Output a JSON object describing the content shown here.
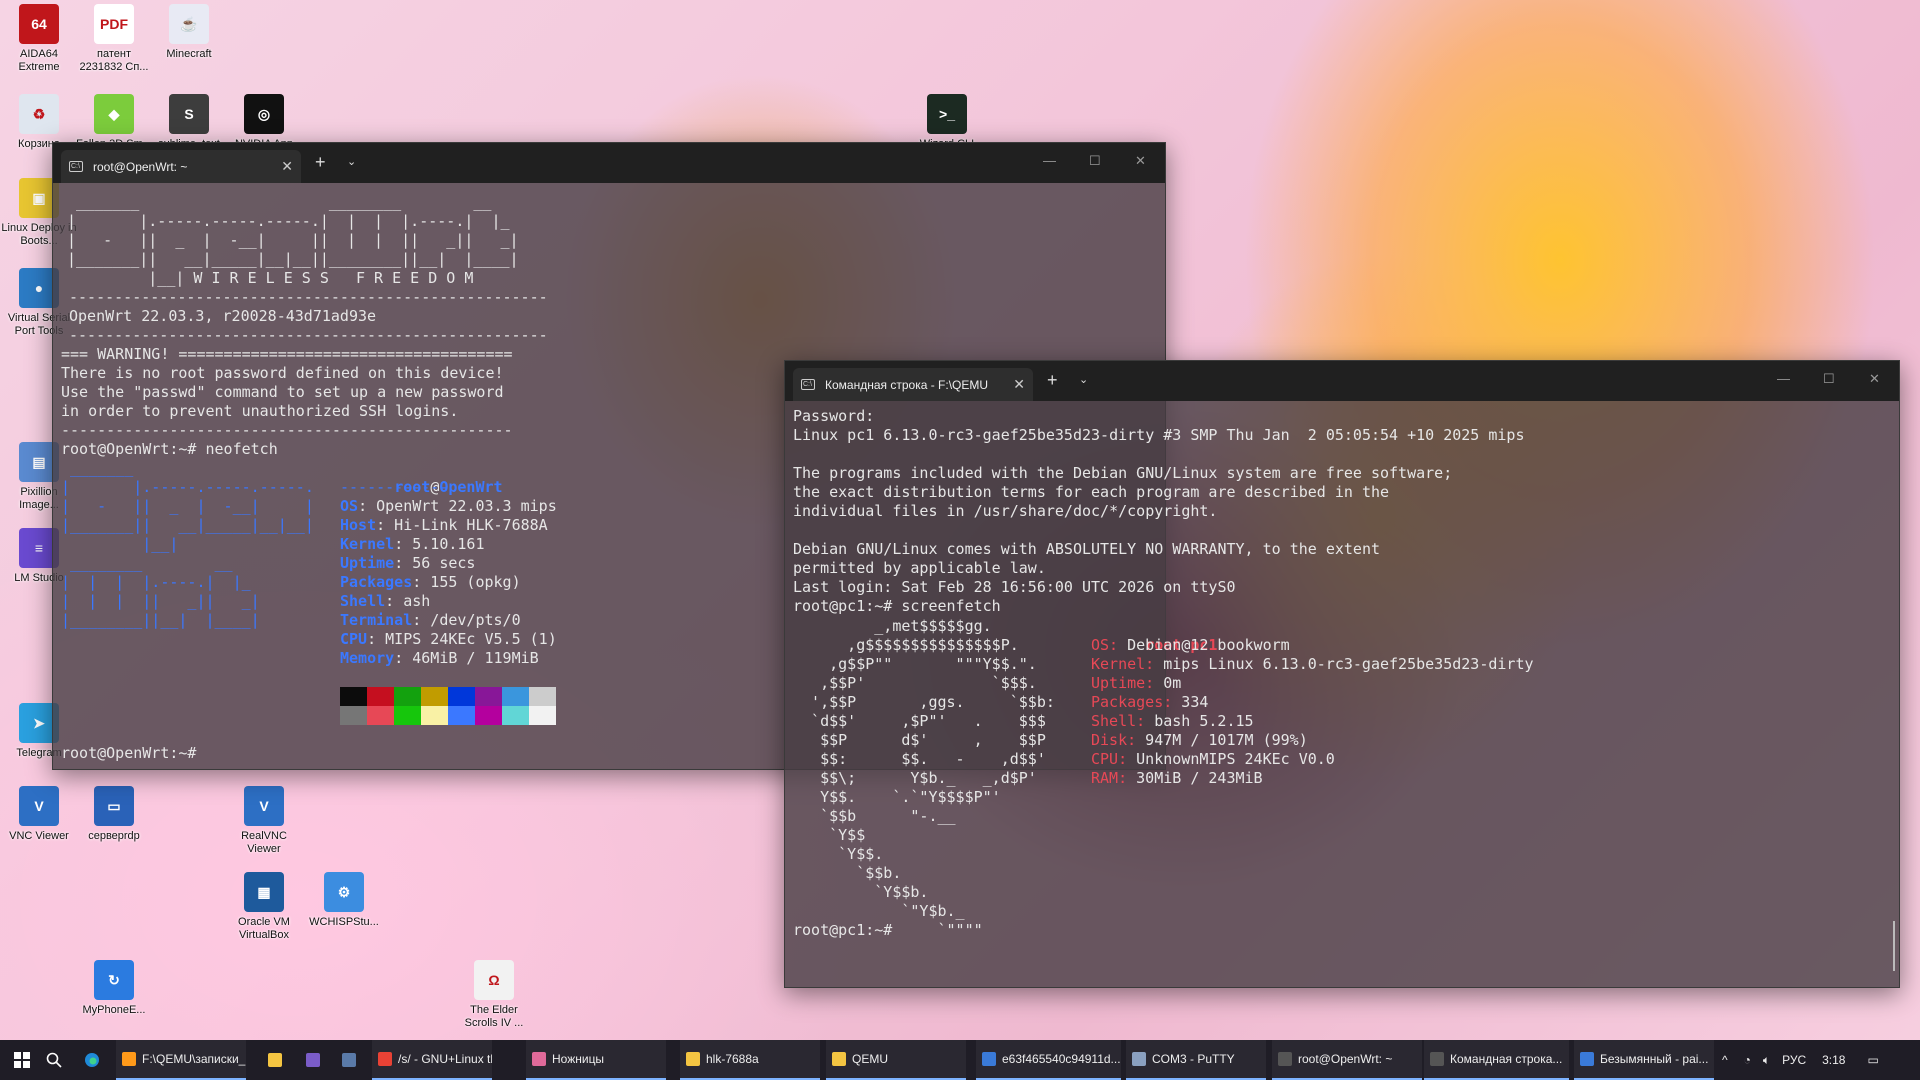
{
  "desktop": {
    "icons": [
      {
        "label": "AIDA64 Extreme",
        "icon": "aida64-icon",
        "color": "#c0161b",
        "text": "64"
      },
      {
        "label": "патент 2231832 Сп...",
        "icon": "pdf-icon",
        "color": "#ffffff",
        "text": "PDF"
      },
      {
        "label": "Minecraft",
        "icon": "java-icon",
        "color": "#e8eaf4",
        "text": "☕"
      },
      {
        "label": "Корзина",
        "icon": "recycle-bin-icon",
        "color": "#dfe6ef",
        "text": "♻"
      },
      {
        "label": "Fallen 3D Sm...",
        "icon": "cube-icon",
        "color": "#7ccc3c",
        "text": "◆"
      },
      {
        "label": "sublime_text",
        "icon": "sublime-icon",
        "color": "#3d3d3d",
        "text": "S"
      },
      {
        "label": "NVIDIA App",
        "icon": "nvidia-icon",
        "color": "#111111",
        "text": "◎"
      },
      {
        "label": "Linux Deploy in Boots...",
        "icon": "box-icon",
        "color": "#e7c531",
        "text": "▣"
      },
      {
        "label": "Virtual Serial Port Tools",
        "icon": "globe-icon",
        "color": "#2c7bc4",
        "text": "●"
      },
      {
        "label": "Pixillion Image...",
        "icon": "image-icon",
        "color": "#5a8ad0",
        "text": "▤"
      },
      {
        "label": "LM Studio",
        "icon": "lmstudio-icon",
        "color": "#6a4ad0",
        "text": "≡"
      },
      {
        "label": "Telegram",
        "icon": "telegram-icon",
        "color": "#2aa0df",
        "text": "➤"
      },
      {
        "label": "VNC Viewer",
        "icon": "vnc-icon",
        "color": "#2d6fc4",
        "text": "V"
      },
      {
        "label": "серверrdp",
        "icon": "rdp-icon",
        "color": "#2a62b8",
        "text": "▭"
      },
      {
        "label": "RealVNC Viewer",
        "icon": "realvnc-icon",
        "color": "#2d6fc4",
        "text": "V"
      },
      {
        "label": "Oracle VM VirtualBox",
        "icon": "virtualbox-icon",
        "color": "#1e5a9c",
        "text": "▦"
      },
      {
        "label": "WCHISPStu...",
        "icon": "wch-icon",
        "color": "#3c8de0",
        "text": "⚙"
      },
      {
        "label": "MyPhoneE...",
        "icon": "myphone-icon",
        "color": "#2b7be0",
        "text": "↻"
      },
      {
        "label": "The Elder Scrolls IV ...",
        "icon": "elderscrolls-icon",
        "color": "#f2f2f2",
        "text": "Ω"
      },
      {
        "label": "Wizard CLI",
        "icon": "terminal-shortcut-icon",
        "color": "#1c2a22",
        "text": ">_"
      }
    ]
  },
  "openwrt_window": {
    "tab_title": "root@OpenWrt: ~",
    "close_glyph": "✕",
    "plus_glyph": "+",
    "drop_glyph": "⌄",
    "min_glyph": "—",
    "max_glyph": "☐",
    "x_glyph": "✕",
    "banner_lines": [
      " _______                     ________        __",
      "|       |.-----.-----.-----.|  |  |  |.----.|  |_",
      "|   -   ||  _  |  -__|     ||  |  |  ||   _||   _|",
      "|_______||   __|_____|__|__||________||__|  |____|",
      "         |__| W I R E L E S S   F R E E D O M"
    ],
    "rule": "-----------------------------------------------------",
    "version": "OpenWrt 22.03.3, r20028-43d71ad93e",
    "warning_lines": [
      "=== WARNING! =====================================",
      "There is no root password defined on this device!",
      "Use the \"passwd\" command to set up a new password",
      "in order to prevent unauthorized SSH logins.",
      "--------------------------------------------------"
    ],
    "prompt_cmd": "root@OpenWrt:~# neofetch",
    "logo_lines": [
      " _______",
      "|       |.-----.-----.-----.",
      "|   -   ||  _  |  -__|     |",
      "|_______||   __|_____|__|__|",
      "         |__|",
      " ________        __",
      "|  |  |  |.----.|  |_",
      "|  |  |  ||   _||   _|",
      "|________||__|  |____|"
    ],
    "info_user": "root",
    "info_at": "@",
    "info_host": "OpenWrt",
    "info_sep": "------------",
    "info": [
      {
        "key": "OS",
        "value": "OpenWrt 22.03.3 mips"
      },
      {
        "key": "Host",
        "value": "Hi-Link HLK-7688A"
      },
      {
        "key": "Kernel",
        "value": "5.10.161"
      },
      {
        "key": "Uptime",
        "value": "56 secs"
      },
      {
        "key": "Packages",
        "value": "155 (opkg)"
      },
      {
        "key": "Shell",
        "value": "ash"
      },
      {
        "key": "Terminal",
        "value": "/dev/pts/0"
      },
      {
        "key": "CPU",
        "value": "MIPS 24KEc V5.5 (1)"
      },
      {
        "key": "Memory",
        "value": "46MiB / 119MiB"
      }
    ],
    "palette_top": [
      "#0c0c0c",
      "#c50f1f",
      "#13a10e",
      "#c19c00",
      "#0037da",
      "#881798",
      "#3a96dd",
      "#cccccc"
    ],
    "palette_bottom": [
      "#767676",
      "#e74856",
      "#16c60c",
      "#f9f1a5",
      "#3b78ff",
      "#b4009e",
      "#61d6d6",
      "#f2f2f2"
    ],
    "final_prompt": "root@OpenWrt:~#"
  },
  "qemu_window": {
    "tab_title": "Командная строка - F:\\QEMU",
    "close_glyph": "✕",
    "plus_glyph": "+",
    "drop_glyph": "⌄",
    "min_glyph": "—",
    "max_glyph": "☐",
    "x_glyph": "✕",
    "lines": [
      "Password:",
      "Linux pc1 6.13.0-rc3-gaef25be35d23-dirty #3 SMP Thu Jan  2 05:05:54 +10 2025 mips",
      "",
      "The programs included with the Debian GNU/Linux system are free software;",
      "the exact distribution terms for each program are described in the",
      "individual files in /usr/share/doc/*/copyright.",
      "",
      "Debian GNU/Linux comes with ABSOLUTELY NO WARRANTY, to the extent",
      "permitted by applicable law.",
      "Last login: Sat Feb 28 16:56:00 UTC 2026 on ttyS0",
      "root@pc1:~# screenfetch"
    ],
    "logo_lines": [
      "         _,met$$$$$gg.",
      "      ,g$$$$$$$$$$$$$$$P.",
      "    ,g$$P\"\"       \"\"\"Y$$.\".",
      "   ,$$P'              `$$$.",
      "  ',$$P       ,ggs.     `$$b:",
      "  `d$$'     ,$P\"'   .    $$$",
      "   $$P      d$'     ,    $$P",
      "   $$:      $$.   -    ,d$$'",
      "   $$\\;      Y$b._   _,d$P'",
      "   Y$$.    `.`\"Y$$$$P\"'",
      "   `$$b      \"-.__",
      "    `Y$$",
      "     `Y$$.",
      "       `$$b.",
      "         `Y$$b.",
      "            `\"Y$b._",
      "                `\"\"\"\""
    ],
    "info_user": "root",
    "info_at": "@",
    "info_host": "pc1",
    "info": [
      {
        "key": "OS:",
        "value": "Debian 12 bookworm"
      },
      {
        "key": "Kernel:",
        "value": "mips Linux 6.13.0-rc3-gaef25be35d23-dirty"
      },
      {
        "key": "Uptime:",
        "value": "0m"
      },
      {
        "key": "Packages:",
        "value": "334"
      },
      {
        "key": "Shell:",
        "value": "bash 5.2.15"
      },
      {
        "key": "Disk:",
        "value": "947M / 1017M (99%)"
      },
      {
        "key": "CPU:",
        "value": "UnknownMIPS 24KEc V0.0"
      },
      {
        "key": "RAM:",
        "value": "30MiB / 243MiB"
      }
    ],
    "final_prompt": "root@pc1:~#"
  },
  "taskbar": {
    "items": [
      {
        "label": "F:\\QEMU\\записки_...",
        "icon": "sublime-icon",
        "color": "#ff9a1a"
      },
      {
        "label": "",
        "icon": "folder-icon",
        "color": "#f4c542"
      },
      {
        "label": "",
        "icon": "eclipse-icon",
        "color": "#7a5cc8"
      },
      {
        "label": "",
        "icon": "steam-icon",
        "color": "#5a7aa8"
      },
      {
        "label": "/s/ - GNU+Linux th...",
        "icon": "chrome-icon",
        "color": "#e94235"
      },
      {
        "label": "Ножницы",
        "icon": "scissors-icon",
        "color": "#e06a9a"
      },
      {
        "label": "hlk-7688a",
        "icon": "folder-icon",
        "color": "#f4c542"
      },
      {
        "label": "QEMU",
        "icon": "folder-icon",
        "color": "#f4c542"
      },
      {
        "label": "e63f465540c94911d...",
        "icon": "image-viewer-icon",
        "color": "#3a7ad8"
      },
      {
        "label": "COM3 - PuTTY",
        "icon": "putty-icon",
        "color": "#8aa0c0"
      },
      {
        "label": "root@OpenWrt: ~",
        "icon": "terminal-icon",
        "color": "#555555"
      },
      {
        "label": "Командная строка...",
        "icon": "terminal-icon",
        "color": "#555555"
      },
      {
        "label": "Безымянный - pai...",
        "icon": "paint-icon",
        "color": "#3a7ad8"
      }
    ],
    "tray": {
      "chevron": "^",
      "lang": "РУС",
      "time": "3:18"
    }
  }
}
